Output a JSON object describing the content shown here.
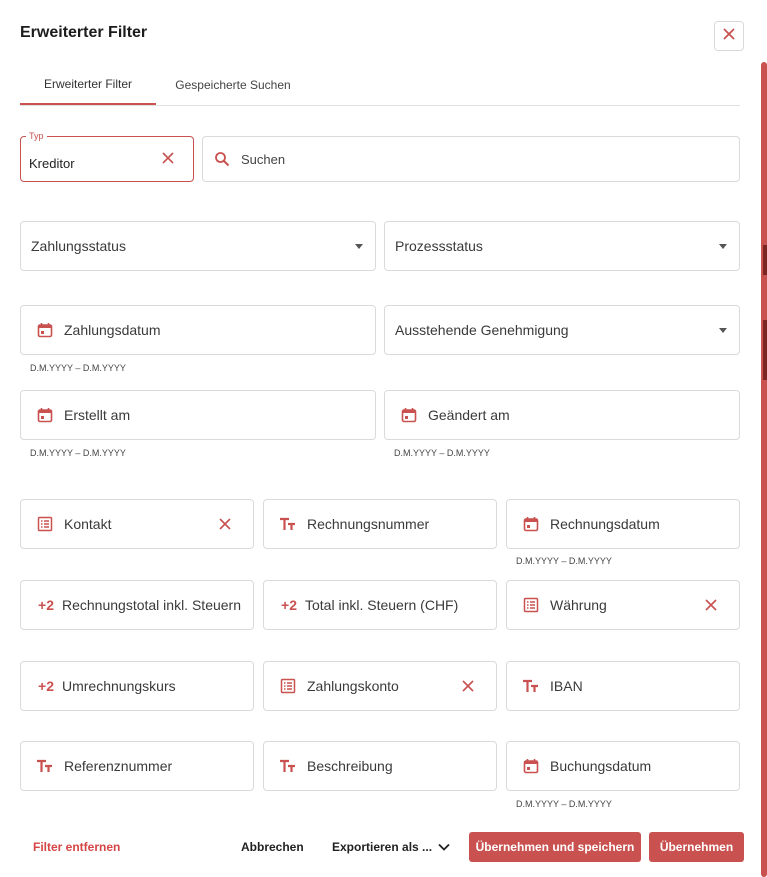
{
  "dialog": {
    "title": "Erweiterter Filter"
  },
  "tabs": [
    {
      "label": "Erweiterter Filter",
      "active": true
    },
    {
      "label": "Gespeicherte Suchen",
      "active": false
    }
  ],
  "typ": {
    "legend": "Typ",
    "value": "Kreditor"
  },
  "search": {
    "placeholder": "Suchen",
    "value": ""
  },
  "fields": {
    "zahlungsstatus": {
      "label": "Zahlungsstatus"
    },
    "prozessstatus": {
      "label": "Prozessstatus"
    },
    "zahlungsdatum": {
      "label": "Zahlungsdatum",
      "hint": "D.M.YYYY – D.M.YYYY"
    },
    "ausstehende_genehmigung": {
      "label": "Ausstehende Genehmigung"
    },
    "erstellt_am": {
      "label": "Erstellt am",
      "hint": "D.M.YYYY – D.M.YYYY"
    },
    "geaendert_am": {
      "label": "Geändert am",
      "hint": "D.M.YYYY – D.M.YYYY"
    },
    "kontakt": {
      "label": "Kontakt"
    },
    "rechnungsnummer": {
      "label": "Rechnungsnummer"
    },
    "rechnungsdatum": {
      "label": "Rechnungsdatum",
      "hint": "D.M.YYYY – D.M.YYYY"
    },
    "rechnungstotal": {
      "label": "Rechnungstotal inkl. Steuern"
    },
    "total_chf": {
      "label": "Total inkl. Steuern (CHF)"
    },
    "waehrung": {
      "label": "Währung"
    },
    "umrechnungskurs": {
      "label": "Umrechnungskurs"
    },
    "zahlungskonto": {
      "label": "Zahlungskonto"
    },
    "iban": {
      "label": "IBAN"
    },
    "referenznummer": {
      "label": "Referenznummer"
    },
    "beschreibung": {
      "label": "Beschreibung"
    },
    "buchungsdatum": {
      "label": "Buchungsdatum",
      "hint": "D.M.YYYY – D.M.YYYY"
    }
  },
  "footer": {
    "remove_filter": "Filter entfernen",
    "cancel": "Abbrechen",
    "export": "Exportieren als ...",
    "apply_save": "Übernehmen und speichern",
    "apply": "Übernehmen"
  },
  "colors": {
    "accent": "#c95250",
    "danger_text": "#d64545"
  },
  "icons": {
    "close": "close-icon",
    "search": "search-icon",
    "calendar": "calendar-icon",
    "list": "list-icon",
    "text": "text-type-icon",
    "number": "number-plus-two-icon",
    "dropdown": "caret-down-icon",
    "chevron": "chevron-down-icon"
  }
}
